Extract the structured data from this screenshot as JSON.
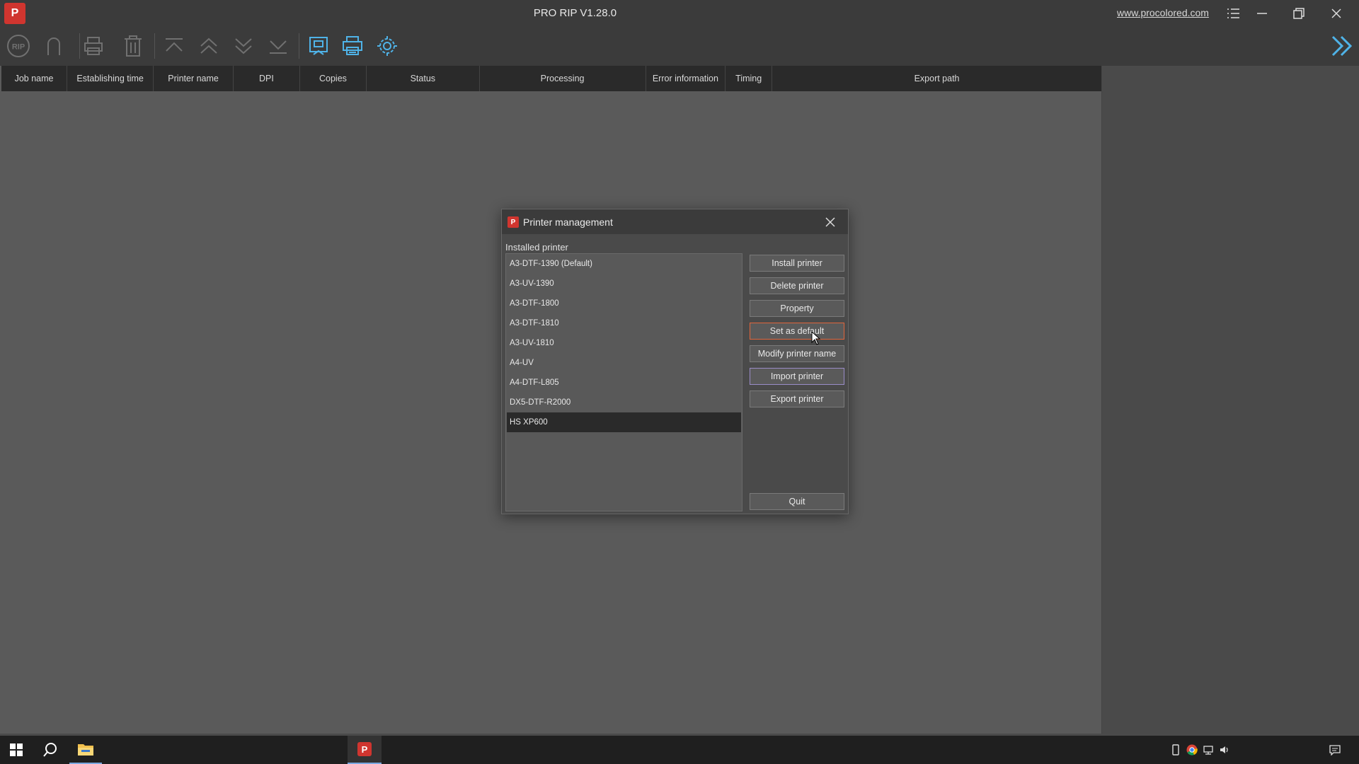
{
  "window": {
    "title": "PRO RIP V1.28.0",
    "link": "www.procolored.com"
  },
  "toolbar": {
    "icons": [
      "rip-icon",
      "magnet-icon",
      "print-icon",
      "trash-icon",
      "move-top-icon",
      "move-up-icon",
      "move-down-icon",
      "move-bottom-icon",
      "preview-icon",
      "printer-manage-icon",
      "settings-icon"
    ]
  },
  "table": {
    "columns": [
      "Job name",
      "Establishing time",
      "Printer name",
      "DPI",
      "Copies",
      "Status",
      "Processing",
      "Error information",
      "Timing",
      "Export path"
    ]
  },
  "dialog": {
    "title": "Printer management",
    "list_label": "Installed printer",
    "printers": [
      "A3-DTF-1390 (Default)",
      "A3-UV-1390",
      "A3-DTF-1800",
      "A3-DTF-1810",
      "A3-UV-1810",
      "A4-UV",
      "A4-DTF-L805",
      "DX5-DTF-R2000",
      "HS XP600"
    ],
    "selected_printer": "HS XP600",
    "buttons": {
      "install": "Install printer",
      "delete": "Delete printer",
      "property": "Property",
      "set_default": "Set as default",
      "modify_name": "Modify printer name",
      "import": "Import printer",
      "export": "Export printer",
      "quit": "Quit"
    }
  },
  "colors": {
    "accent": "#d0352f",
    "toolbar_active": "#4fb3e8",
    "hover_border": "#e0663c"
  }
}
